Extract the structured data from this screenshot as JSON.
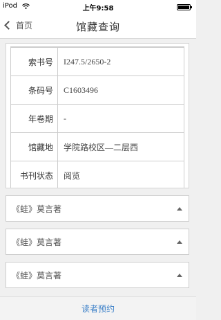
{
  "status_bar": {
    "carrier": "iPod",
    "time": "上午9:58"
  },
  "nav": {
    "back_label": "首页",
    "title": "馆藏查询"
  },
  "details": [
    {
      "label": "索书号",
      "value": "I247.5/2650-2"
    },
    {
      "label": "条码号",
      "value": "C1603496"
    },
    {
      "label": "年卷期",
      "value": "-"
    },
    {
      "label": "馆藏地",
      "value": "学院路校区—二层西"
    },
    {
      "label": "书刊状态",
      "value": "阅览"
    }
  ],
  "collapse_items": [
    {
      "title": "《蛙》莫言著"
    },
    {
      "title": "《蛙》莫言著"
    },
    {
      "title": "《蛙》莫言著"
    }
  ],
  "footer": {
    "reserve_label": "读者预约"
  },
  "colors": {
    "accent": "#3a7fc8"
  }
}
